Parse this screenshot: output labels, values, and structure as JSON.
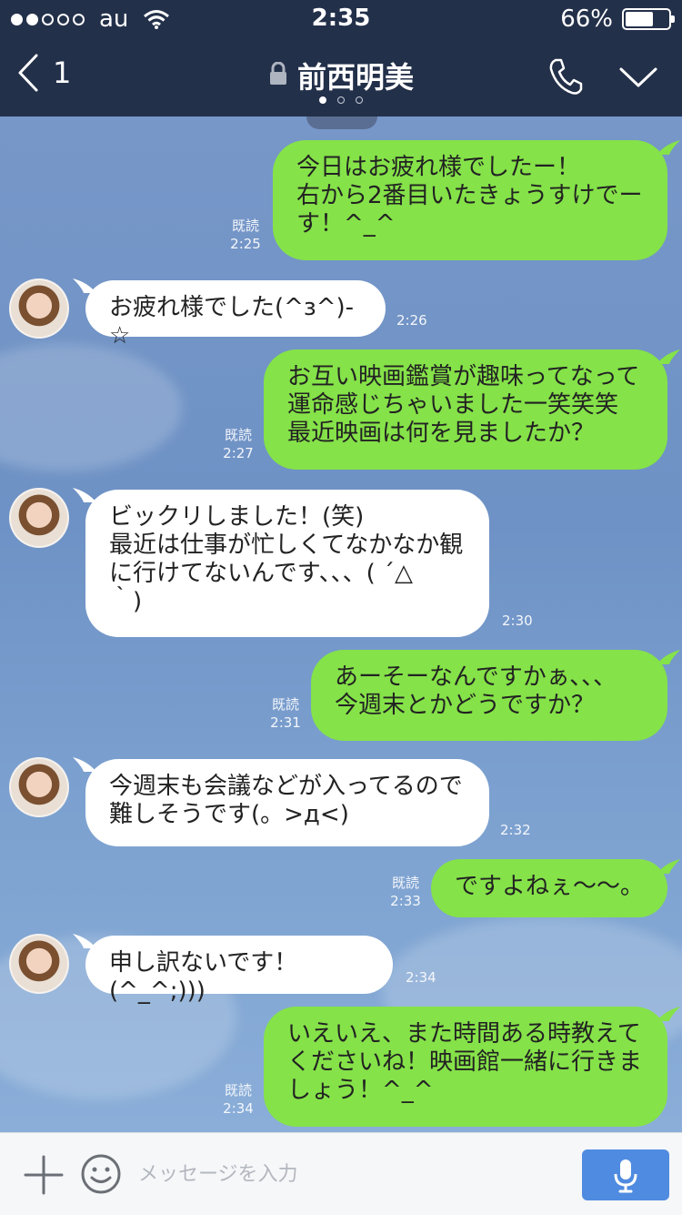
{
  "status_bar": {
    "carrier": "au",
    "time": "2:35",
    "battery_percent": "66%",
    "battery_level": 0.66,
    "signal_bars_filled": 2,
    "signal_bars_total": 5
  },
  "header": {
    "back_count": "1",
    "title": "前西明美",
    "page_dots": 3,
    "active_page": 0
  },
  "messages": [
    {
      "dir": "out",
      "text": "今日はお疲れ様でしたー！\n右から2番目いたきょうすけでー\nす！^_^",
      "read": "既読",
      "time": "2:25"
    },
    {
      "dir": "in",
      "text": "お疲れ様でした(^з^)-☆",
      "time": "2:26"
    },
    {
      "dir": "out",
      "text": "お互い映画鑑賞が趣味ってなって\n運命感じちゃいました一笑笑笑\n最近映画は何を見ましたか？",
      "read": "既読",
      "time": "2:27"
    },
    {
      "dir": "in",
      "text": "ビックリしました！(笑)\n最近は仕事が忙しくてなかなか観\nに行けてないんです、、、( ´△\n｀)",
      "time": "2:30"
    },
    {
      "dir": "out",
      "text": "あーそーなんですかぁ、、、\n今週末とかどうですか？",
      "read": "既読",
      "time": "2:31"
    },
    {
      "dir": "in",
      "text": "今週末も会議などが入ってるので\n難しそうです(。>д<)",
      "time": "2:32"
    },
    {
      "dir": "out",
      "text": "ですよねぇ〜〜。",
      "read": "既読",
      "time": "2:33"
    },
    {
      "dir": "in",
      "text": "申し訳ないです！(^_^;)))",
      "time": "2:34"
    },
    {
      "dir": "out",
      "text": "いえいえ、また時間ある時教えて\nくださいね！映画館一緒に行きま\nしょう！^_^",
      "read": "既読",
      "time": "2:34"
    }
  ],
  "input": {
    "placeholder": "メッセージを入力"
  },
  "colors": {
    "header_bg": "#23304a",
    "outgoing_bubble": "#85e249",
    "incoming_bubble": "#ffffff",
    "mic_button": "#4f8be0"
  },
  "icons": {
    "back": "chevron-left-icon",
    "lock": "lock-icon",
    "phone": "phone-icon",
    "menu": "chevron-down-icon",
    "plus": "plus-icon",
    "emoji": "smiley-icon",
    "mic": "microphone-icon"
  }
}
